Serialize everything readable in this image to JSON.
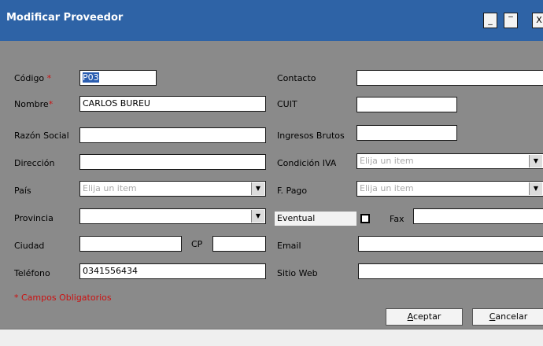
{
  "window": {
    "title": "Modificar Proveedor",
    "minimize": "_",
    "maximize": "‾",
    "close": "X"
  },
  "form": {
    "codigo_label": "Código",
    "codigo_value": "P03",
    "nombre_label": "Nombre",
    "nombre_value": "CARLOS BUREU",
    "razon_label": "Razón Social",
    "direccion_label": "Dirección",
    "pais_label": "País",
    "pais_value": "Elija un item",
    "provincia_label": "Provincia",
    "ciudad_label": "Ciudad",
    "cp_label": "CP",
    "telefono_label": "Teléfono",
    "telefono_value": "0341556434",
    "required_mark": "*",
    "required_note": "* Campos Obligatorios",
    "contacto_label": "Contacto",
    "cuit_label": "CUIT",
    "ingresos_label": "Ingresos Brutos",
    "condicion_label": "Condición IVA",
    "condicion_value": "Elija un item",
    "fpago_label": "F. Pago",
    "fpago_value": "Elija un item",
    "eventual_label": "Eventual",
    "fax_label": "Fax",
    "email_label": "Email",
    "web_label": "Sitio Web"
  },
  "buttons": {
    "aceptar_u": "A",
    "aceptar_rest": "ceptar",
    "cancelar_u": "C",
    "cancelar_rest": "ancelar"
  },
  "colors": {
    "titlebar": "#2e63a6",
    "background": "#8a8a8a",
    "required": "#cc1111"
  }
}
